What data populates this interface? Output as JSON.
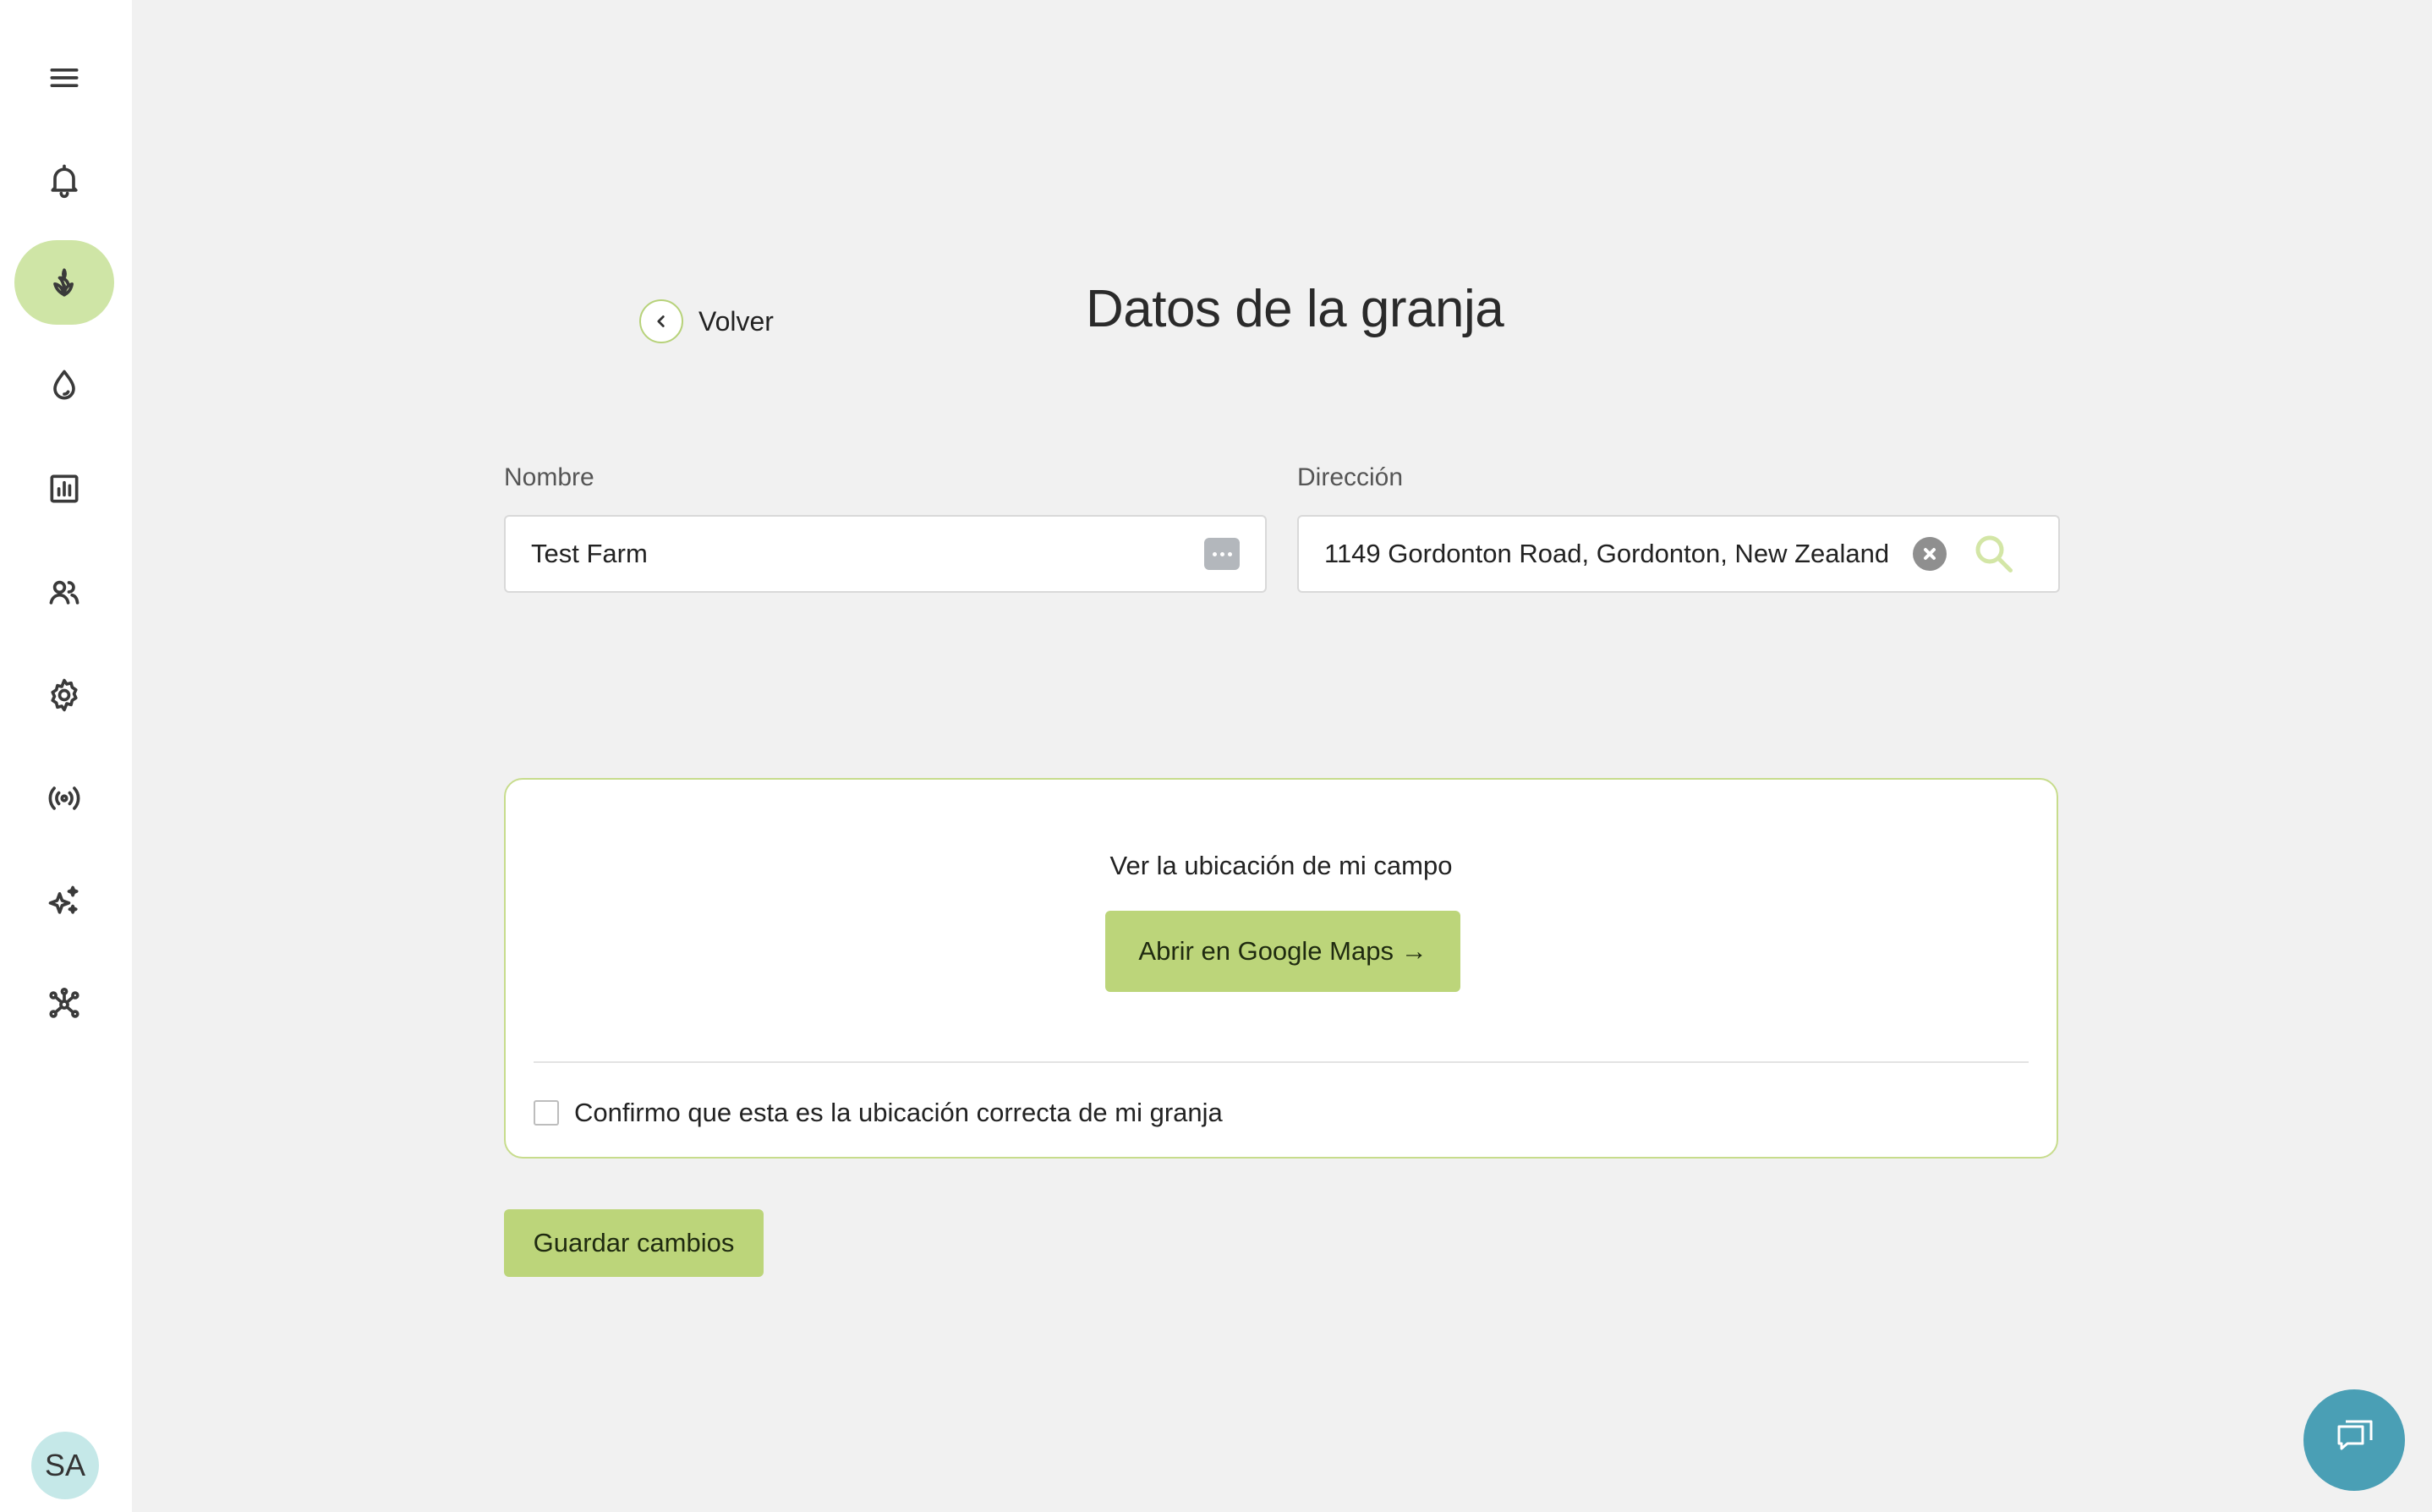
{
  "sidebar": {
    "items": [
      {
        "icon": "menu-icon"
      },
      {
        "icon": "bell-icon"
      },
      {
        "icon": "plant-icon",
        "active": true
      },
      {
        "icon": "water-drop-icon"
      },
      {
        "icon": "chart-icon"
      },
      {
        "icon": "users-icon"
      },
      {
        "icon": "gear-icon"
      },
      {
        "icon": "signal-icon"
      },
      {
        "icon": "sparkle-icon"
      },
      {
        "icon": "network-icon"
      }
    ],
    "avatar_initials": "SA"
  },
  "header": {
    "back_label": "Volver",
    "title": "Datos de la granja"
  },
  "form": {
    "name_label": "Nombre",
    "name_value": "Test Farm",
    "address_label": "Dirección",
    "address_value": "1149 Gordonton Road, Gordonton, New Zealand"
  },
  "location_card": {
    "text": "Ver la ubicación de mi campo",
    "maps_button": "Abrir en Google Maps →",
    "confirm_label": "Confirmo que esta es la ubicación correcta de mi granja",
    "confirmed": false
  },
  "actions": {
    "save_label": "Guardar cambios"
  },
  "colors": {
    "accent": "#bcd57a",
    "active_nav": "#cfe5a6",
    "chat": "#4a9fb5"
  }
}
